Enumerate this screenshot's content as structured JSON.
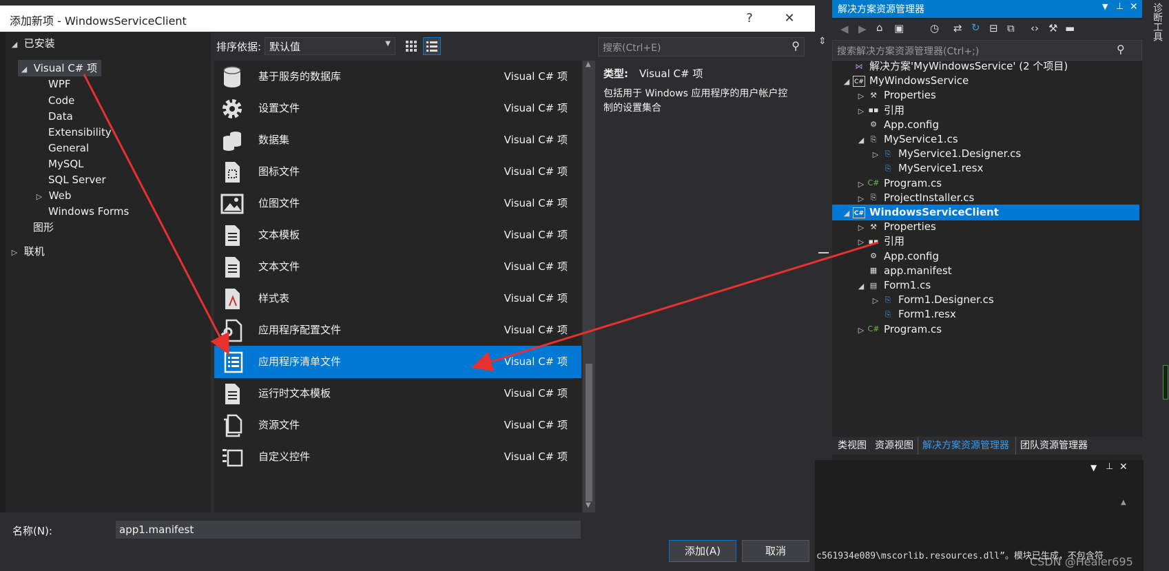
{
  "dialog": {
    "title": "添加新项 - WindowsServiceClient",
    "help_label": "?",
    "close_label": "✕",
    "tree": [
      {
        "label": "已安装",
        "arrow": "◢"
      },
      {
        "label": "Visual C# 项",
        "arrow": "◢"
      },
      {
        "label": "WPF"
      },
      {
        "label": "Code"
      },
      {
        "label": "Data"
      },
      {
        "label": "Extensibility"
      },
      {
        "label": "General"
      },
      {
        "label": "MySQL"
      },
      {
        "label": "SQL Server"
      },
      {
        "label": "Web",
        "arrow": "▷"
      },
      {
        "label": "Windows Forms"
      },
      {
        "label": "图形"
      },
      {
        "label": "联机",
        "arrow": "▷"
      }
    ],
    "sort_label": "排序依据:",
    "sort_value": "默认值",
    "search_placeholder": "搜索(Ctrl+E)",
    "items": [
      {
        "name": "基于服务的数据库",
        "type": "Visual C# 项",
        "icon": "database-icon"
      },
      {
        "name": "设置文件",
        "type": "Visual C# 项",
        "icon": "gear-icon"
      },
      {
        "name": "数据集",
        "type": "Visual C# 项",
        "icon": "dataset-icon"
      },
      {
        "name": "图标文件",
        "type": "Visual C# 项",
        "icon": "icon-file-icon"
      },
      {
        "name": "位图文件",
        "type": "Visual C# 项",
        "icon": "bitmap-icon"
      },
      {
        "name": "文本模板",
        "type": "Visual C# 项",
        "icon": "text-template-icon"
      },
      {
        "name": "文本文件",
        "type": "Visual C# 项",
        "icon": "text-file-icon"
      },
      {
        "name": "样式表",
        "type": "Visual C# 项",
        "icon": "stylesheet-icon"
      },
      {
        "name": "应用程序配置文件",
        "type": "Visual C# 项",
        "icon": "config-file-icon"
      },
      {
        "name": "应用程序清单文件",
        "type": "Visual C# 项",
        "icon": "manifest-icon",
        "selected": true
      },
      {
        "name": "运行时文本模板",
        "type": "Visual C# 项",
        "icon": "runtime-template-icon"
      },
      {
        "name": "资源文件",
        "type": "Visual C# 项",
        "icon": "resource-file-icon"
      },
      {
        "name": "自定义控件",
        "type": "Visual C# 项",
        "icon": "custom-control-icon"
      }
    ],
    "desc": {
      "type_label": "类型:",
      "type_value": "Visual C# 项",
      "text": "包括用于 Windows 应用程序的用户帐户控制的设置集合"
    },
    "name_label": "名称(N):",
    "name_value": "app1.manifest",
    "add_button": "添加(A)",
    "cancel_button": "取消"
  },
  "solution_explorer": {
    "title": "解决方案资源管理器",
    "search_placeholder": "搜索解决方案资源管理器(Ctrl+;)",
    "rows": [
      {
        "label": "解决方案'MyWindowsService' (2 个项目)",
        "icon": "solution-icon",
        "arrow": ""
      },
      {
        "label": "MyWindowsService",
        "icon": "csharp-project-icon",
        "arrow": "◢"
      },
      {
        "label": "Properties",
        "icon": "wrench-icon",
        "arrow": "▷"
      },
      {
        "label": "引用",
        "icon": "references-icon",
        "arrow": "▷"
      },
      {
        "label": "App.config",
        "icon": "config-icon",
        "arrow": ""
      },
      {
        "label": "MyService1.cs",
        "icon": "service-file-icon",
        "arrow": "◢"
      },
      {
        "label": "MyService1.Designer.cs",
        "icon": "designer-file-icon",
        "arrow": "▷"
      },
      {
        "label": "MyService1.resx",
        "icon": "resx-icon",
        "arrow": ""
      },
      {
        "label": "Program.cs",
        "icon": "csharp-file-icon",
        "arrow": "▷"
      },
      {
        "label": "ProjectInstaller.cs",
        "icon": "service-file-icon",
        "arrow": "▷"
      },
      {
        "label": "WindowsServiceClient",
        "icon": "csharp-project-icon",
        "arrow": "◢",
        "selected": true
      },
      {
        "label": "Properties",
        "icon": "wrench-icon",
        "arrow": "▷"
      },
      {
        "label": "引用",
        "icon": "references-icon",
        "arrow": "▷"
      },
      {
        "label": "App.config",
        "icon": "config-icon",
        "arrow": ""
      },
      {
        "label": "app.manifest",
        "icon": "manifest-file-icon",
        "arrow": ""
      },
      {
        "label": "Form1.cs",
        "icon": "form-icon",
        "arrow": "◢"
      },
      {
        "label": "Form1.Designer.cs",
        "icon": "designer-file-icon",
        "arrow": "▷"
      },
      {
        "label": "Form1.resx",
        "icon": "resx-icon",
        "arrow": ""
      },
      {
        "label": "Program.cs",
        "icon": "csharp-file-icon",
        "arrow": "▷"
      }
    ],
    "tabs": [
      "类视图",
      "资源视图",
      "解决方案资源管理器",
      "团队资源管理器"
    ]
  },
  "output": {
    "line": "c561934e089\\mscorlib.resources.dll”。模块已生成，不包含符",
    "watermark": "CSDN @Healer695"
  },
  "side_strip_label": "诊断工具",
  "colors": {
    "accent": "#0078d4",
    "annotation_arrow": "#e8302f"
  }
}
